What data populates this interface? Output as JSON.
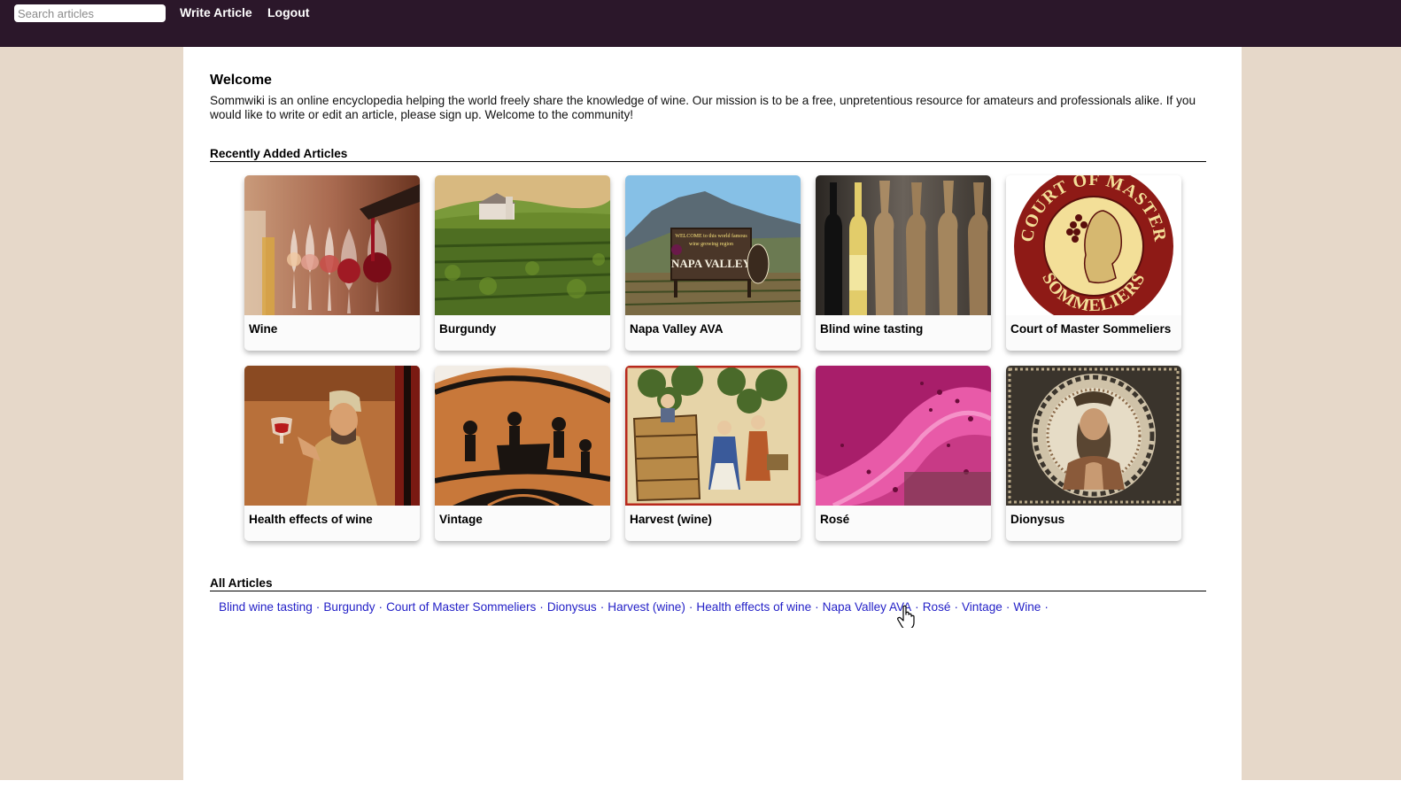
{
  "topbar": {
    "search_placeholder": "Search articles",
    "write_article": "Write Article",
    "logout": "Logout",
    "bg_color": "#2b172a"
  },
  "welcome": {
    "title": "Welcome",
    "text": "Sommwiki is an online encyclopedia helping the world freely share the knowledge of wine. Our mission is to be a free, unpretentious resource for amateurs and professionals alike. If you would like to write or edit an article, please sign up. Welcome to the community!"
  },
  "recent": {
    "heading": "Recently Added Articles",
    "articles": [
      {
        "title": "Wine",
        "image": "wine-glasses-pour-icon"
      },
      {
        "title": "Burgundy",
        "image": "vineyard-chateau-icon"
      },
      {
        "title": "Napa Valley AVA",
        "image": "napa-valley-sign-icon"
      },
      {
        "title": "Blind wine tasting",
        "image": "wrapped-bottles-icon"
      },
      {
        "title": "Court of Master Sommeliers",
        "image": "sommelier-seal-icon"
      },
      {
        "title": "Health effects of wine",
        "image": "medieval-drinker-icon"
      },
      {
        "title": "Vintage",
        "image": "greek-pottery-icon"
      },
      {
        "title": "Harvest (wine)",
        "image": "medieval-harvest-icon"
      },
      {
        "title": "Rosé",
        "image": "pink-must-icon"
      },
      {
        "title": "Dionysus",
        "image": "dionysus-mosaic-icon"
      }
    ]
  },
  "all_articles": {
    "heading": "All Articles",
    "links": [
      "Blind wine tasting",
      "Burgundy",
      "Court of Master Sommeliers",
      "Dionysus",
      "Harvest (wine)",
      "Health effects of wine",
      "Napa Valley AVA",
      "Rosé",
      "Vintage",
      "Wine"
    ],
    "separator": "·"
  },
  "seal_text": {
    "top": "COURT OF MASTER",
    "bottom": "SOMMELIERS"
  },
  "napa_sign": {
    "line1": "WELCOME to this world famous",
    "line2": "wine growing region",
    "line3": "NAPA VALLEY"
  }
}
